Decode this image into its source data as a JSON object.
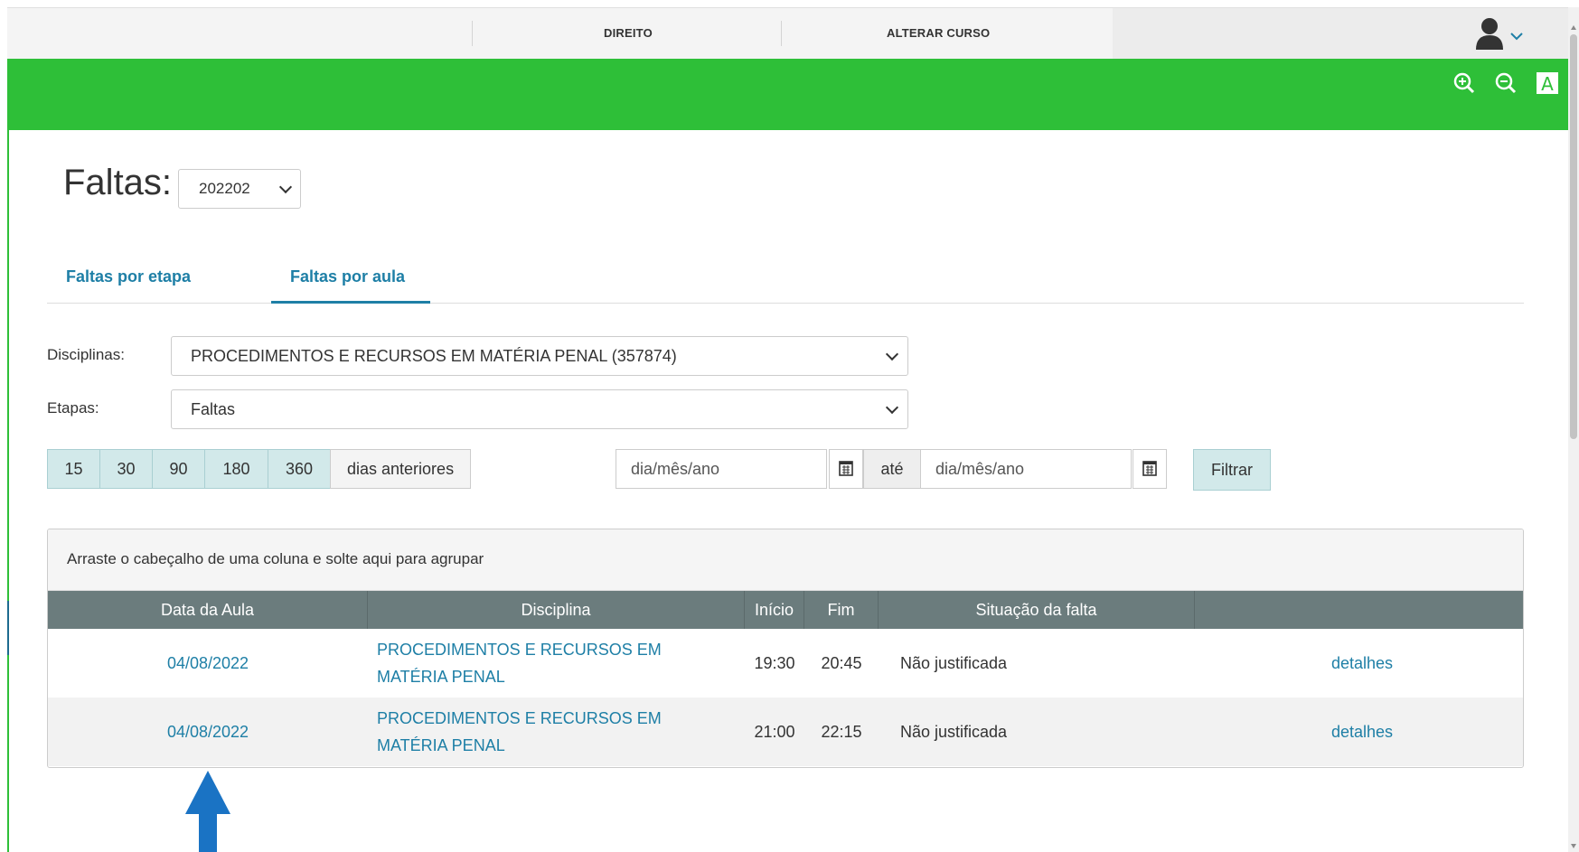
{
  "topnav": {
    "course": "DIREITO",
    "change_course": "ALTERAR CURSO",
    "user_icon": "user-icon",
    "chevron_icon": "chevron-down-icon"
  },
  "toolbar": {
    "icons": [
      "zoom-in-icon",
      "zoom-out-icon",
      "font-contrast-icon"
    ],
    "contrast_letter": "A"
  },
  "colors": {
    "brand_green": "#2ebf38",
    "accent_blue": "#1e7fa6",
    "header_grey": "#6b7c7d",
    "arrow_blue": "#1a73c4"
  },
  "page": {
    "title": "Faltas:",
    "period": "202202"
  },
  "tabs": [
    {
      "label": "Faltas por etapa",
      "active": false
    },
    {
      "label": "Faltas por aula",
      "active": true
    }
  ],
  "filters": {
    "disciplinas_label": "Disciplinas:",
    "disciplinas_value": "PROCEDIMENTOS E RECURSOS EM MATÉRIA PENAL (357874)",
    "etapas_label": "Etapas:",
    "etapas_value": "Faltas",
    "day_options": [
      "15",
      "30",
      "90",
      "180",
      "360"
    ],
    "days_suffix": "dias anteriores",
    "date_from_placeholder": "dia/mês/ano",
    "until_label": "até",
    "date_to_placeholder": "dia/mês/ano",
    "filter_button": "Filtrar"
  },
  "grid": {
    "group_hint": "Arraste o cabeçalho de uma coluna e solte aqui para agrupar",
    "columns": [
      "Data da Aula",
      "Disciplina",
      "Início",
      "Fim",
      "Situação da falta",
      ""
    ],
    "rows": [
      {
        "date": "04/08/2022",
        "disc_line1": "PROCEDIMENTOS E RECURSOS EM",
        "disc_line2": "MATÉRIA PENAL",
        "start": "19:30",
        "end": "20:45",
        "status": "Não justificada",
        "action": "detalhes"
      },
      {
        "date": "04/08/2022",
        "disc_line1": "PROCEDIMENTOS E RECURSOS EM",
        "disc_line2": "MATÉRIA PENAL",
        "start": "21:00",
        "end": "22:15",
        "status": "Não justificada",
        "action": "detalhes"
      }
    ]
  }
}
